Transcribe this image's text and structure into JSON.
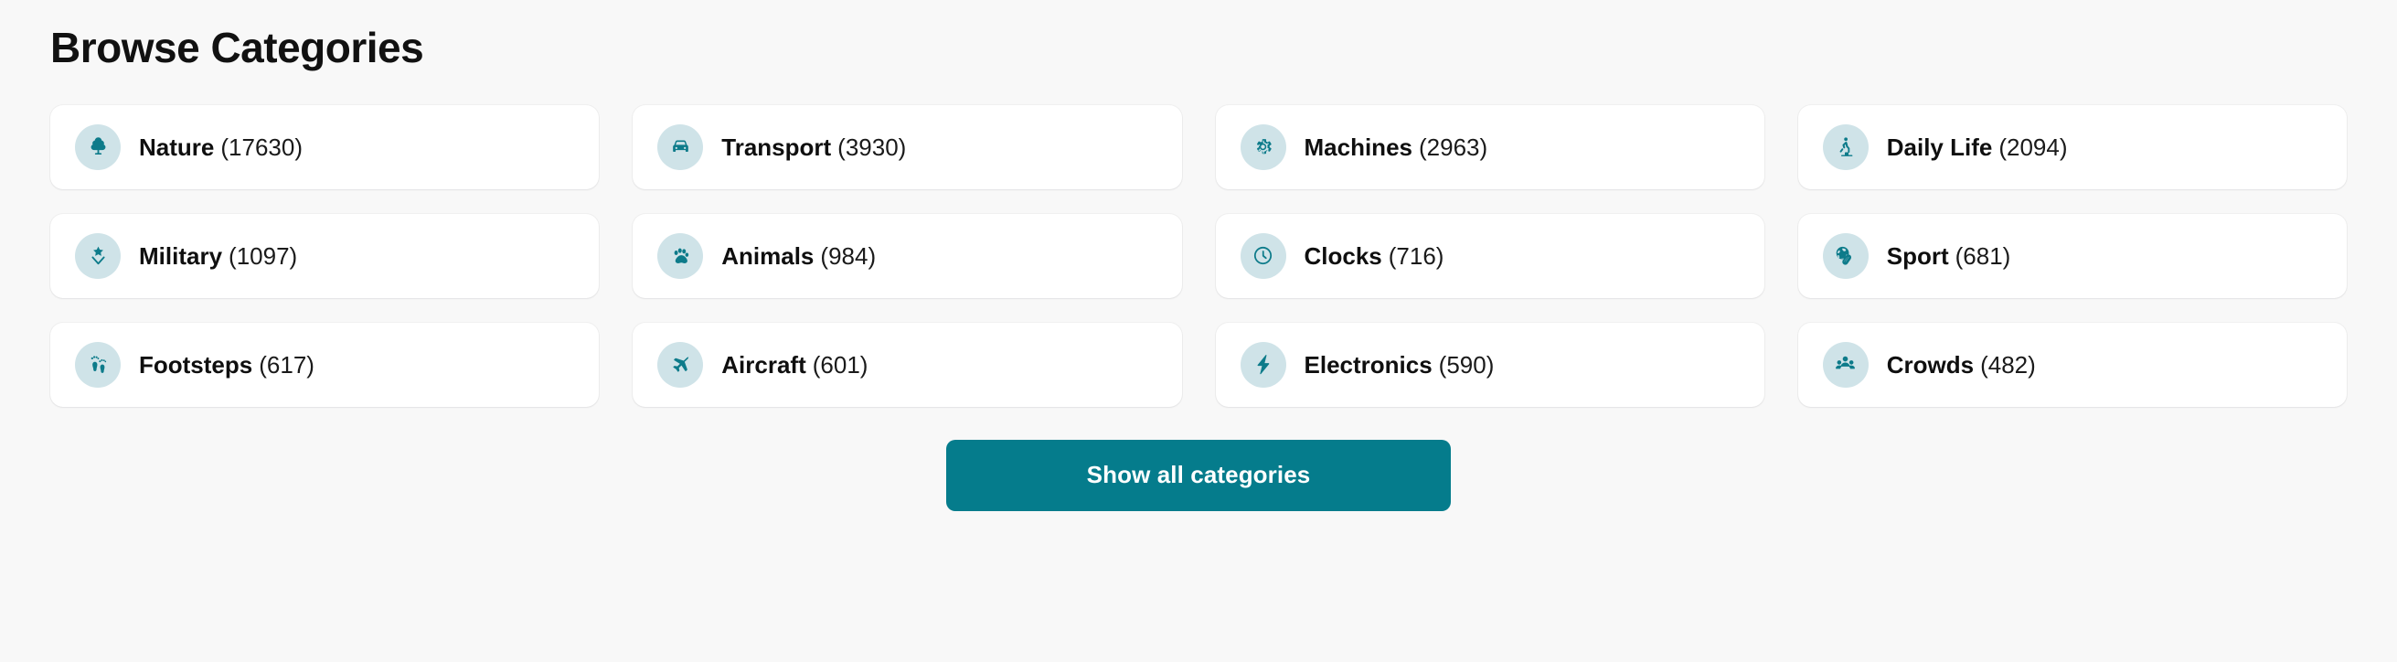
{
  "header": {
    "title": "Browse Categories"
  },
  "theme": {
    "page_background": "#f8f8f8",
    "card_background": "#ffffff",
    "accent_teal": "#057c8c",
    "icon_glyph_color": "#0d7b8a",
    "icon_badge_background": "#cfe3e8",
    "text_color": "#111111"
  },
  "categories": [
    {
      "label": "Nature",
      "count": "(17630)",
      "icon": "tree-icon"
    },
    {
      "label": "Transport",
      "count": "(3930)",
      "icon": "car-icon"
    },
    {
      "label": "Machines",
      "count": "(2963)",
      "icon": "gear-icon"
    },
    {
      "label": "Daily Life",
      "count": "(2094)",
      "icon": "person-stairs-icon"
    },
    {
      "label": "Military",
      "count": "(1097)",
      "icon": "rank-star-icon"
    },
    {
      "label": "Animals",
      "count": "(984)",
      "icon": "paw-icon"
    },
    {
      "label": "Clocks",
      "count": "(716)",
      "icon": "clock-icon"
    },
    {
      "label": "Sport",
      "count": "(681)",
      "icon": "sports-ball-icon"
    },
    {
      "label": "Footsteps",
      "count": "(617)",
      "icon": "footprints-icon"
    },
    {
      "label": "Aircraft",
      "count": "(601)",
      "icon": "airplane-icon"
    },
    {
      "label": "Electronics",
      "count": "(590)",
      "icon": "lightning-bolt-icon"
    },
    {
      "label": "Crowds",
      "count": "(482)",
      "icon": "people-group-icon"
    }
  ],
  "footer": {
    "show_all_label": "Show all categories"
  }
}
